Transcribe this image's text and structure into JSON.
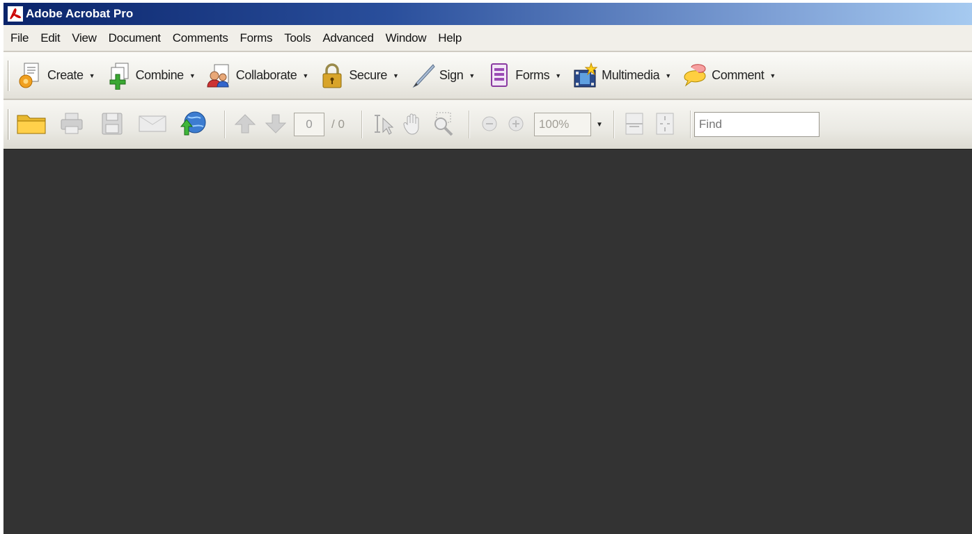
{
  "window": {
    "title": "Adobe Acrobat Pro",
    "icon": "acrobat-logo-icon"
  },
  "menu": [
    "File",
    "Edit",
    "View",
    "Document",
    "Comments",
    "Forms",
    "Tools",
    "Advanced",
    "Window",
    "Help"
  ],
  "tasks": [
    {
      "label": "Create",
      "icon": "create-pdf-icon"
    },
    {
      "label": "Combine",
      "icon": "combine-files-icon"
    },
    {
      "label": "Collaborate",
      "icon": "collaborate-icon"
    },
    {
      "label": "Secure",
      "icon": "lock-icon"
    },
    {
      "label": "Sign",
      "icon": "pen-icon"
    },
    {
      "label": "Forms",
      "icon": "forms-icon"
    },
    {
      "label": "Multimedia",
      "icon": "multimedia-icon"
    },
    {
      "label": "Comment",
      "icon": "comment-icon"
    }
  ],
  "toolbar": {
    "page_current": "0",
    "page_total": "/ 0",
    "zoom": "100%",
    "find_placeholder": "Find"
  },
  "colors": {
    "title_start": "#0a246a",
    "title_end": "#a6caf0",
    "document_area": "#333333",
    "toolbar_bg": "#efeee8"
  }
}
